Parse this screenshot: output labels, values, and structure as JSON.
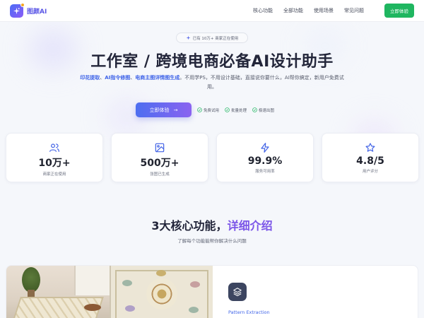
{
  "brand": {
    "name": "图颜AI",
    "accent": "#5b57e6",
    "cta_color": "#1fb660"
  },
  "nav": {
    "links": [
      "核心功能",
      "全部功能",
      "使用场景",
      "常见问题"
    ],
    "cta": "立即体验"
  },
  "hero": {
    "badge": "已有 10万+ 商家正在使用",
    "title": "工作室 / 跨境电商必备AI设计助手",
    "subtitle": {
      "highlights": [
        "印花提取",
        "AI指令修图",
        "电商主图详情图生成"
      ],
      "sep": "、",
      "rest": "。不用学PS，不用设计基础，直接说你要什么，AI帮你搞定，新用户免费试用。"
    },
    "cta": "立即体验",
    "checks": [
      "免费试用",
      "批量处理",
      "极速出图"
    ]
  },
  "stats": [
    {
      "icon": "users-icon",
      "value": "10万+",
      "label": "商家正在使用"
    },
    {
      "icon": "image-icon",
      "value": "500万+",
      "label": "张图已生成"
    },
    {
      "icon": "lightning-icon",
      "value": "99.9%",
      "label": "服务可用率"
    },
    {
      "icon": "star-icon",
      "value": "4.8/5",
      "label": "用户评分"
    }
  ],
  "features": {
    "title_prefix": "3大核心功能，",
    "title_accent": "详细介绍",
    "subtitle": "了解每个功能能帮你解决什么问题",
    "first": {
      "icon": "layers-icon",
      "name_en": "Pattern Extraction"
    }
  }
}
